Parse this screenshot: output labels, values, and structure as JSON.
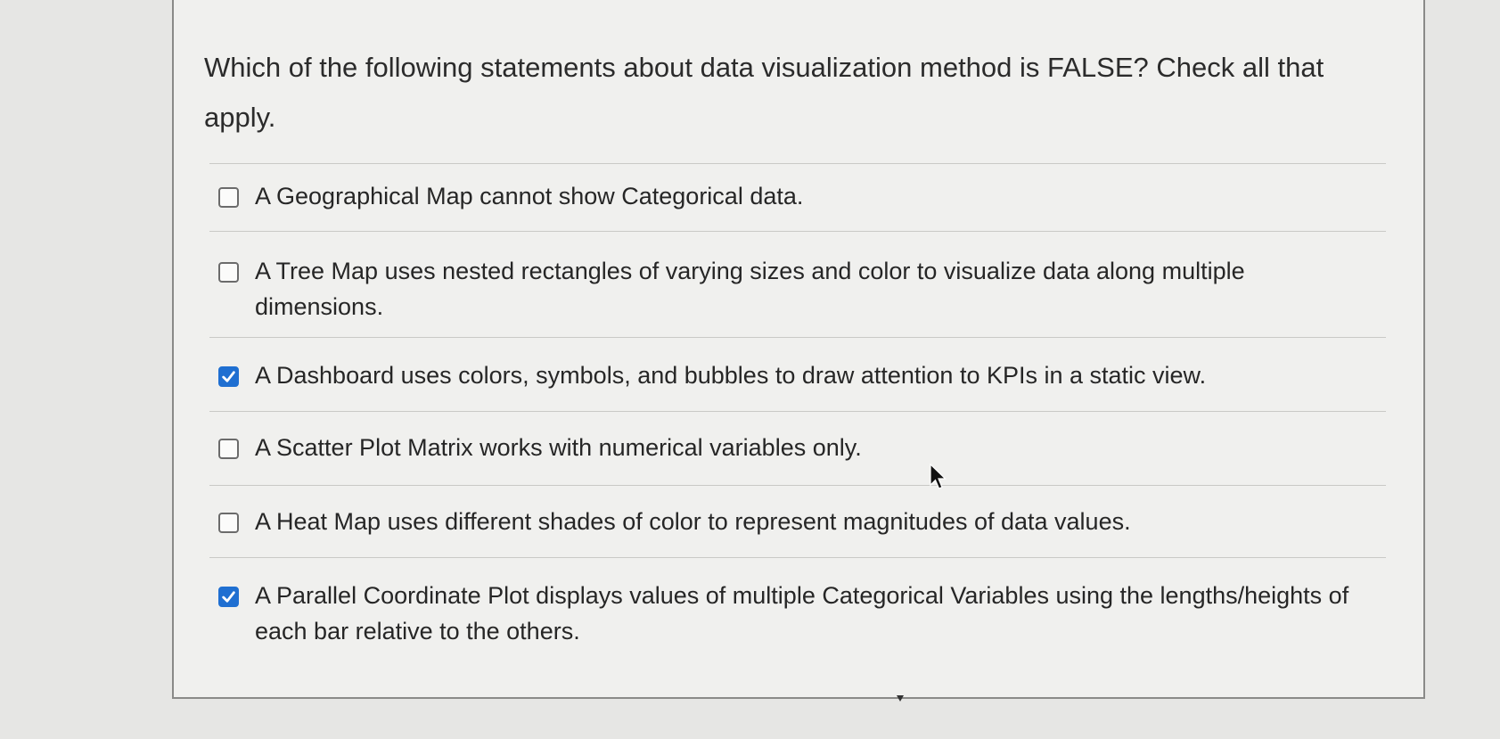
{
  "question": {
    "text": "Which of the following statements about data visualization method is FALSE? Check all that apply."
  },
  "answers": [
    {
      "label": "A Geographical Map cannot show Categorical data.",
      "checked": false
    },
    {
      "label": "A Tree Map uses nested rectangles of varying sizes and color to visualize data along multiple dimensions.",
      "checked": false
    },
    {
      "label": "A Dashboard uses colors, symbols, and bubbles to draw attention to KPIs in a static view.",
      "checked": true
    },
    {
      "label": "A Scatter Plot Matrix works with numerical variables only.",
      "checked": false
    },
    {
      "label": "A Heat Map uses different shades of color to represent magnitudes of data values.",
      "checked": false
    },
    {
      "label": "A Parallel Coordinate Plot displays values of multiple Categorical Variables using the lengths/heights of each bar relative to the others.",
      "checked": true
    }
  ],
  "colors": {
    "checkbox_checked": "#1f6fd1",
    "background": "#e6e6e4",
    "card": "#f0f0ee"
  },
  "icons": {
    "check": "checkmark-icon",
    "cursor": "mouse-pointer-icon"
  }
}
